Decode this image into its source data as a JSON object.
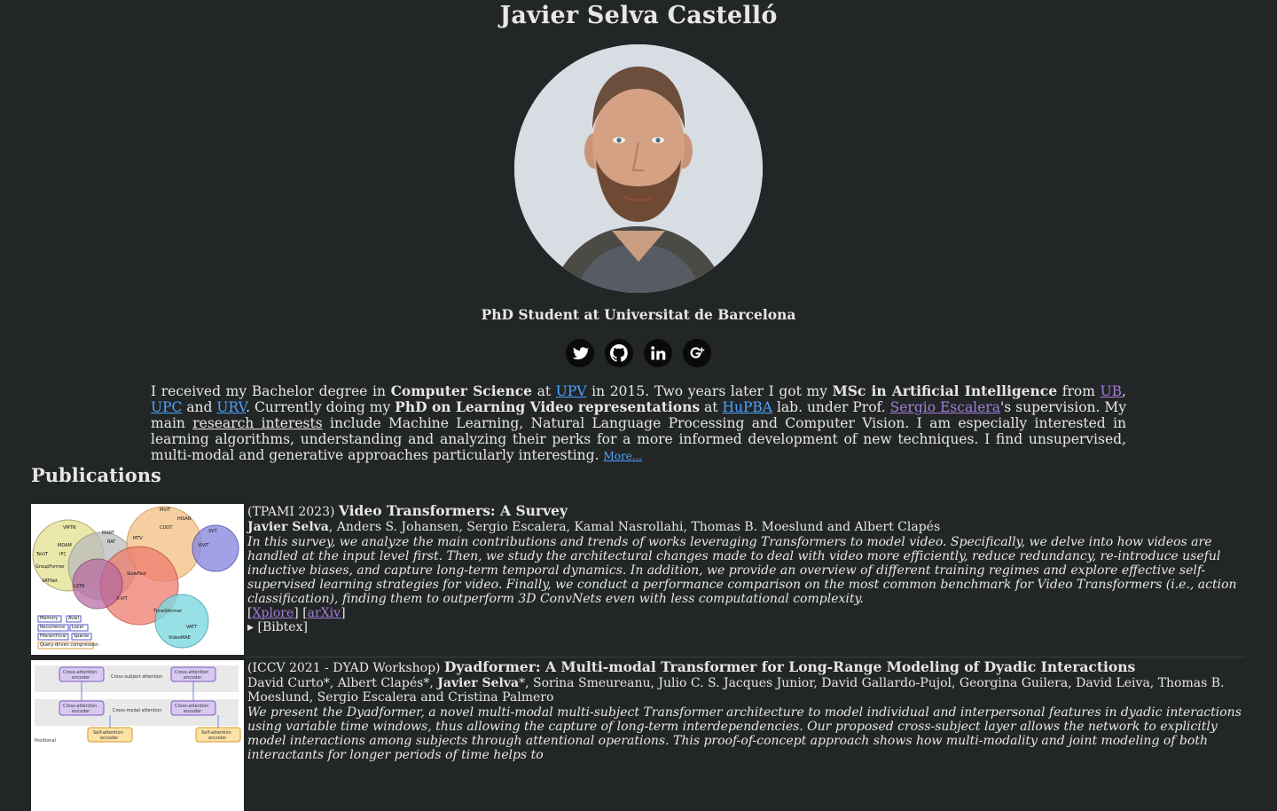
{
  "header": {
    "name": "Javier Selva Castelló",
    "subtitle": "PhD Student at Universitat de Barcelona"
  },
  "social": [
    {
      "icon": "twitter-icon"
    },
    {
      "icon": "github-icon"
    },
    {
      "icon": "linkedin-icon"
    },
    {
      "icon": "google-scholar-icon"
    }
  ],
  "bio": {
    "t1": "I received my Bachelor degree in ",
    "b1": "Computer Science",
    "t2": " at ",
    "l_upv1": "UPV",
    "t3": " in 2015. Two years later I got my ",
    "b2": "MSc in Artificial Intelligence",
    "t4": " from ",
    "l_ub": "UB",
    "t5": ", ",
    "l_upc": "UPC",
    "t6": " and ",
    "l_urv": "URV",
    "t7": ". Currently doing my ",
    "b3": "PhD on Learning Video representations",
    "t8": " at ",
    "l_hupba": "HuPBA",
    "t9": " lab. under Prof. ",
    "l_escalera": "Sergio Escalera",
    "t10": "'s supervision. My main ",
    "u_research": "research interests",
    "t11": " include Machine Learning, Natural Language Processing and Computer Vision. I am especially interested in learning algorithms, understanding and analyzing their perks for a more informed development of new techniques. I find unsupervised, multi-modal and generative approaches particularly interesting. ",
    "more": "More..."
  },
  "publications": {
    "heading": "Publications",
    "items": [
      {
        "venue": "(TPAMI 2023) ",
        "title": "Video Transformers: A Survey",
        "author_self": "Javier Selva",
        "authors_rest": ", Anders S. Johansen, Sergio Escalera, Kamal Nasrollahi, Thomas B. Moeslund and Albert Clapés",
        "abstract": "In this survey, we analyze the main contributions and trends of works leveraging Transformers to model video. Specifically, we delve into how videos are handled at the input level first. Then, we study the architectural changes made to deal with video more efficiently, reduce redundancy, re-introduce useful inductive biases, and capture long-term temporal dynamics. In addition, we provide an overview of different training regimes and explore effective self-supervised learning strategies for video. Finally, we conduct a performance comparison on the most common benchmark for Video Transformers (i.e., action classification), finding them to outperform 3D ConvNets even with less computational complexity.",
        "link1": "Xplore",
        "link2": "arXiv",
        "bibtex": "[Bibtex]"
      },
      {
        "venue": "(ICCV 2021 - DYAD Workshop) ",
        "title": "Dyadformer: A Multi-modal Transformer for Long-Range Modeling of Dyadic Interactions",
        "authors_pre": "David Curto*, Albert Clapés*, ",
        "author_self": "Javier Selva",
        "authors_rest": "*, Sorina Smeureanu, Julio C. S. Jacques Junior, David Gallardo-Pujol, Georgina Guilera, David Leiva, Thomas B. Moeslund, Sergio Escalera and Cristina Palmero",
        "abstract": "We present the Dyadformer, a novel multi-modal multi-subject Transformer architecture to model individual and interpersonal features in dyadic interactions using variable time windows, thus allowing the capture of long-term interdependencies. Our proposed cross-subject layer allows the network to explicitly model interactions among subjects through attentional operations. This proof-of-concept approach shows how multi-modality and joint modeling of both interactants for longer periods of time helps to"
      }
    ]
  },
  "figure1_labels": [
    "VMTN",
    "MART",
    "MViT",
    "HiSAN",
    "COOT",
    "SVT",
    "MDAM",
    "RAT",
    "MTV",
    "TeViT",
    "IFC",
    "ViViT",
    "Memory",
    "Recurrence",
    "Hierarchical",
    "Query-driven compression",
    "Local",
    "Sparse",
    "Avail",
    "LSTR",
    "VATNet",
    "X-VIT",
    "VideoMAE",
    "VATT",
    "GroupFormer",
    "TimeSformer",
    "SlowFast"
  ],
  "figure2_labels": [
    "Cross-attention encoder",
    "Cross-subject attention",
    "Cross-modal attention",
    "Self-attention encoder",
    "Positional"
  ]
}
